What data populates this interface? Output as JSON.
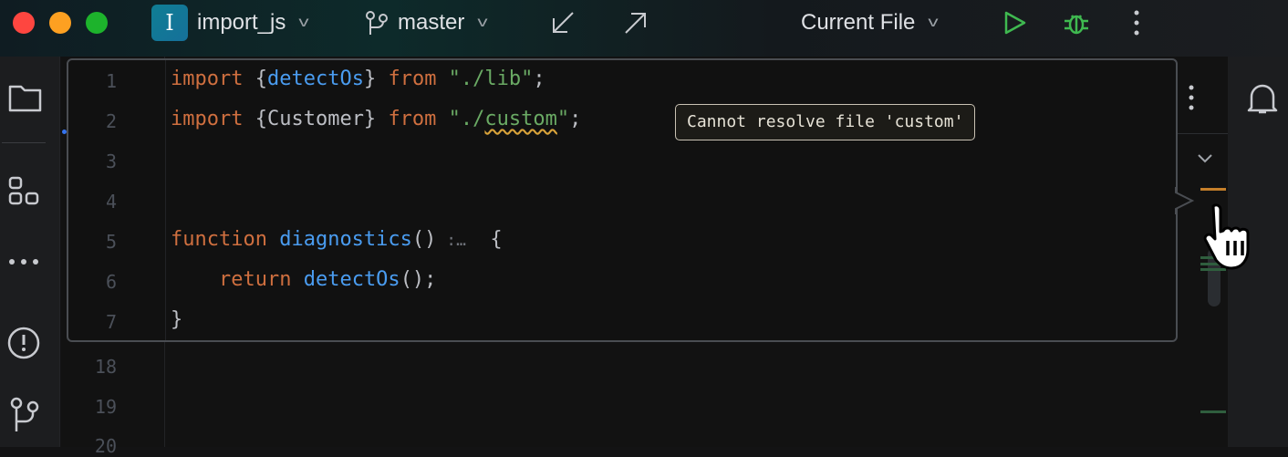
{
  "window": {
    "project_initial": "I",
    "project_name": "import_js",
    "branch": "master",
    "run_config": "Current File"
  },
  "tooltip": "Cannot resolve file 'custom'",
  "popup_lines": [
    {
      "n": "1"
    },
    {
      "n": "2"
    },
    {
      "n": "3"
    },
    {
      "n": "4"
    },
    {
      "n": "5"
    },
    {
      "n": "6"
    },
    {
      "n": "7"
    }
  ],
  "code": {
    "l1": {
      "kw": "import",
      "open": " {",
      "name": "detectOs",
      "close": "} ",
      "from": "from",
      "str": " \"./lib\"",
      "end": ";"
    },
    "l2": {
      "kw": "import",
      "name": " {Customer} ",
      "from": "from",
      "q1": " \"./",
      "path": "custom",
      "q2": "\"",
      "end": ";"
    },
    "l5": {
      "kw": "function",
      "name": " diagnostics",
      "paren": "()",
      "hint": " :…",
      "brace": "  {"
    },
    "l6": {
      "indent": "    ",
      "kw": "return",
      "name": " detectOs",
      "end": "();"
    },
    "l7": "}"
  },
  "editor_lines": [
    "18",
    "19",
    "20"
  ],
  "colors": {
    "keyword": "#cf6f3f",
    "function": "#4a9cf0",
    "string": "#6aaa64",
    "warning": "#d9a33a"
  }
}
